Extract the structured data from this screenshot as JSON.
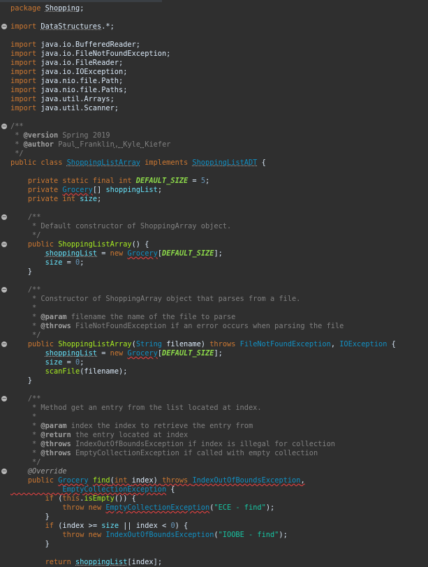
{
  "editor": {
    "lines": [
      {
        "fold": false,
        "tokens": [
          [
            "kw",
            "package "
          ],
          [
            "pl",
            "Shopping"
          ],
          [
            "pl",
            ";"
          ]
        ],
        "spell": [
          1
        ]
      },
      {
        "fold": false,
        "tokens": []
      },
      {
        "fold": true,
        "tokens": [
          [
            "kw",
            "import "
          ],
          [
            "pl",
            "DataStructures"
          ],
          [
            "pl",
            ".*;"
          ]
        ],
        "spell": [
          1
        ]
      },
      {
        "fold": false,
        "tokens": []
      },
      {
        "fold": false,
        "tokens": [
          [
            "kw",
            "import "
          ],
          [
            "pl",
            "java.io.BufferedReader;"
          ]
        ]
      },
      {
        "fold": false,
        "tokens": [
          [
            "kw",
            "import "
          ],
          [
            "pl",
            "java.io.FileNotFoundException;"
          ]
        ]
      },
      {
        "fold": false,
        "tokens": [
          [
            "kw",
            "import "
          ],
          [
            "pl",
            "java.io.FileReader;"
          ]
        ]
      },
      {
        "fold": false,
        "tokens": [
          [
            "kw",
            "import "
          ],
          [
            "pl",
            "java.io.IOException;"
          ]
        ]
      },
      {
        "fold": false,
        "tokens": [
          [
            "kw",
            "import "
          ],
          [
            "pl",
            "java.nio.file.Path;"
          ]
        ]
      },
      {
        "fold": false,
        "tokens": [
          [
            "kw",
            "import "
          ],
          [
            "pl",
            "java.nio.file.Paths;"
          ]
        ]
      },
      {
        "fold": false,
        "tokens": [
          [
            "kw",
            "import "
          ],
          [
            "pl",
            "java.util.Arrays;"
          ]
        ]
      },
      {
        "fold": false,
        "tokens": [
          [
            "kw",
            "import "
          ],
          [
            "pl",
            "java.util.Scanner;"
          ]
        ]
      },
      {
        "fold": false,
        "tokens": []
      },
      {
        "fold": true,
        "tokens": [
          [
            "cm",
            "/**"
          ]
        ]
      },
      {
        "fold": false,
        "tokens": [
          [
            "cm",
            " * "
          ],
          [
            "tag",
            "@version"
          ],
          [
            "cm",
            " Spring 2019"
          ]
        ]
      },
      {
        "fold": false,
        "tokens": [
          [
            "cm",
            " * "
          ],
          [
            "tag",
            "@author"
          ],
          [
            "cm",
            " "
          ],
          [
            "cm",
            "Paul"
          ],
          [
            "cm",
            " "
          ],
          [
            "cm",
            "Franklin"
          ],
          [
            "cm",
            ", "
          ],
          [
            "cm",
            "Kyle"
          ],
          [
            "cm",
            " "
          ],
          [
            "cm",
            "Kiefer"
          ]
        ],
        "spell": [
          4,
          6,
          8,
          10
        ]
      },
      {
        "fold": false,
        "tokens": [
          [
            "cm",
            " */"
          ]
        ]
      },
      {
        "fold": false,
        "tokens": [
          [
            "kw",
            "public class "
          ],
          [
            "ty",
            "ShoppingListArray"
          ],
          [
            "kw",
            " implements "
          ],
          [
            "ty",
            "ShoppingListADT"
          ],
          [
            "pl",
            " {"
          ]
        ],
        "spell": [
          1,
          3
        ]
      },
      {
        "fold": false,
        "tokens": []
      },
      {
        "fold": false,
        "tokens": [
          [
            "pl",
            "    "
          ],
          [
            "kw",
            "private static final int "
          ],
          [
            "cst",
            "DEFAULT_SIZE"
          ],
          [
            "pl",
            " = "
          ],
          [
            "num",
            "5"
          ],
          [
            "pl",
            ";"
          ]
        ]
      },
      {
        "fold": false,
        "tokens": [
          [
            "pl",
            "    "
          ],
          [
            "kw",
            "private "
          ],
          [
            "ty",
            "Grocery"
          ],
          [
            "pl",
            "[] "
          ],
          [
            "fld",
            "shoppingList"
          ],
          [
            "pl",
            ";"
          ]
        ],
        "err": [
          2
        ]
      },
      {
        "fold": false,
        "tokens": [
          [
            "pl",
            "    "
          ],
          [
            "kw",
            "private int "
          ],
          [
            "fld",
            "size"
          ],
          [
            "pl",
            ";"
          ]
        ]
      },
      {
        "fold": false,
        "tokens": []
      },
      {
        "fold": true,
        "tokens": [
          [
            "pl",
            "    "
          ],
          [
            "cm",
            "/**"
          ]
        ]
      },
      {
        "fold": false,
        "tokens": [
          [
            "cm",
            "     * Default constructor of ShoppingArray object."
          ]
        ]
      },
      {
        "fold": false,
        "tokens": [
          [
            "cm",
            "     */"
          ]
        ]
      },
      {
        "fold": true,
        "tokens": [
          [
            "pl",
            "    "
          ],
          [
            "kw",
            "public "
          ],
          [
            "mth",
            "ShoppingListArray"
          ],
          [
            "pl",
            "() {"
          ]
        ]
      },
      {
        "fold": false,
        "tokens": [
          [
            "pl",
            "        "
          ],
          [
            "fld",
            "shoppingList"
          ],
          [
            "pl",
            " = "
          ],
          [
            "kw",
            "new "
          ],
          [
            "ty",
            "Grocery"
          ],
          [
            "pl",
            "["
          ],
          [
            "cst",
            "DEFAULT_SIZE"
          ],
          [
            "pl",
            "];"
          ]
        ],
        "spell": [
          1
        ],
        "err": [
          4
        ]
      },
      {
        "fold": false,
        "tokens": [
          [
            "pl",
            "        "
          ],
          [
            "fld",
            "size"
          ],
          [
            "pl",
            " = "
          ],
          [
            "num",
            "0"
          ],
          [
            "pl",
            ";"
          ]
        ]
      },
      {
        "fold": false,
        "tokens": [
          [
            "pl",
            "    }"
          ]
        ]
      },
      {
        "fold": false,
        "tokens": []
      },
      {
        "fold": true,
        "tokens": [
          [
            "pl",
            "    "
          ],
          [
            "cm",
            "/**"
          ]
        ]
      },
      {
        "fold": false,
        "tokens": [
          [
            "cm",
            "     * Constructor of ShoppingArray object that parses from a file."
          ]
        ]
      },
      {
        "fold": false,
        "tokens": [
          [
            "cm",
            "     *"
          ]
        ]
      },
      {
        "fold": false,
        "tokens": [
          [
            "cm",
            "     * "
          ],
          [
            "tag",
            "@param"
          ],
          [
            "cm",
            " filename the name of the file to parse"
          ]
        ]
      },
      {
        "fold": false,
        "tokens": [
          [
            "cm",
            "     * "
          ],
          [
            "tag",
            "@throws"
          ],
          [
            "cm",
            " FileNotFoundException if an error occurs when parsing the file"
          ]
        ]
      },
      {
        "fold": false,
        "tokens": [
          [
            "cm",
            "     */"
          ]
        ]
      },
      {
        "fold": true,
        "tokens": [
          [
            "pl",
            "    "
          ],
          [
            "kw",
            "public "
          ],
          [
            "mth",
            "ShoppingListArray"
          ],
          [
            "pl",
            "("
          ],
          [
            "ty",
            "String"
          ],
          [
            "pl",
            " filename) "
          ],
          [
            "kw",
            "throws "
          ],
          [
            "ty",
            "FileNotFoundException"
          ],
          [
            "pl",
            ", "
          ],
          [
            "ty",
            "IOException"
          ],
          [
            "pl",
            " {"
          ]
        ]
      },
      {
        "fold": false,
        "tokens": [
          [
            "pl",
            "        "
          ],
          [
            "fld",
            "shoppingList"
          ],
          [
            "pl",
            " = "
          ],
          [
            "kw",
            "new "
          ],
          [
            "ty",
            "Grocery"
          ],
          [
            "pl",
            "["
          ],
          [
            "cst",
            "DEFAULT_SIZE"
          ],
          [
            "pl",
            "];"
          ]
        ],
        "spell": [
          1
        ],
        "err": [
          4
        ]
      },
      {
        "fold": false,
        "tokens": [
          [
            "pl",
            "        "
          ],
          [
            "fld",
            "size"
          ],
          [
            "pl",
            " = "
          ],
          [
            "num",
            "0"
          ],
          [
            "pl",
            ";"
          ]
        ]
      },
      {
        "fold": false,
        "tokens": [
          [
            "pl",
            "        "
          ],
          [
            "mth",
            "scanFile"
          ],
          [
            "pl",
            "(filename);"
          ]
        ]
      },
      {
        "fold": false,
        "tokens": [
          [
            "pl",
            "    }"
          ]
        ]
      },
      {
        "fold": false,
        "tokens": []
      },
      {
        "fold": true,
        "tokens": [
          [
            "pl",
            "    "
          ],
          [
            "cm",
            "/**"
          ]
        ]
      },
      {
        "fold": false,
        "tokens": [
          [
            "cm",
            "     * Method get an entry from the list located at index."
          ]
        ]
      },
      {
        "fold": false,
        "tokens": [
          [
            "cm",
            "     *"
          ]
        ]
      },
      {
        "fold": false,
        "tokens": [
          [
            "cm",
            "     * "
          ],
          [
            "tag",
            "@param"
          ],
          [
            "cm",
            " index the index to retrieve the entry from"
          ]
        ]
      },
      {
        "fold": false,
        "tokens": [
          [
            "cm",
            "     * "
          ],
          [
            "tag",
            "@return"
          ],
          [
            "cm",
            " the entry located at index"
          ]
        ]
      },
      {
        "fold": false,
        "tokens": [
          [
            "cm",
            "     * "
          ],
          [
            "tag",
            "@throws"
          ],
          [
            "cm",
            " IndexOutOfBoundsException if index is illegal for collection"
          ]
        ]
      },
      {
        "fold": false,
        "tokens": [
          [
            "cm",
            "     * "
          ],
          [
            "tag",
            "@throws"
          ],
          [
            "cm",
            " EmptyCollectionException if called with empty collection"
          ]
        ]
      },
      {
        "fold": false,
        "tokens": [
          [
            "cm",
            "     */"
          ]
        ]
      },
      {
        "fold": true,
        "tokens": [
          [
            "pl",
            "    "
          ],
          [
            "ann",
            "@Override"
          ]
        ]
      },
      {
        "fold": false,
        "tokens": [
          [
            "pl",
            "    "
          ],
          [
            "kw",
            "public "
          ],
          [
            "ty",
            "Grocery"
          ],
          [
            "pl",
            " "
          ],
          [
            "mth",
            "find"
          ],
          [
            "pl",
            "("
          ],
          [
            "kw",
            "int "
          ],
          [
            "pl",
            "index) "
          ],
          [
            "kw",
            "throws "
          ],
          [
            "ty",
            "IndexOutOfBoundsException"
          ],
          [
            "pl",
            ","
          ]
        ],
        "err": [
          2,
          4,
          5,
          6,
          7,
          8,
          9,
          10
        ]
      },
      {
        "fold": false,
        "tokens": [
          [
            "pl",
            "            "
          ],
          [
            "ty",
            "EmptyCollectionException"
          ],
          [
            "pl",
            " {"
          ]
        ],
        "err": [
          0,
          1
        ]
      },
      {
        "fold": false,
        "tokens": [
          [
            "pl",
            "        "
          ],
          [
            "kw",
            "if "
          ],
          [
            "pl",
            "("
          ],
          [
            "kw",
            "this"
          ],
          [
            "pl",
            "."
          ],
          [
            "mth",
            "isEmpty"
          ],
          [
            "pl",
            "()) {"
          ]
        ]
      },
      {
        "fold": false,
        "tokens": [
          [
            "pl",
            "            "
          ],
          [
            "kw",
            "throw new "
          ],
          [
            "ty",
            "EmptyCollectionException"
          ],
          [
            "pl",
            "("
          ],
          [
            "str",
            "\"ECE - find\""
          ],
          [
            "pl",
            ");"
          ]
        ],
        "err": [
          2
        ]
      },
      {
        "fold": false,
        "tokens": [
          [
            "pl",
            "        }"
          ]
        ]
      },
      {
        "fold": false,
        "tokens": [
          [
            "pl",
            "        "
          ],
          [
            "kw",
            "if "
          ],
          [
            "pl",
            "(index >= "
          ],
          [
            "fld",
            "size"
          ],
          [
            "pl",
            " || index < "
          ],
          [
            "num",
            "0"
          ],
          [
            "pl",
            ") {"
          ]
        ]
      },
      {
        "fold": false,
        "tokens": [
          [
            "pl",
            "            "
          ],
          [
            "kw",
            "throw new "
          ],
          [
            "ty",
            "IndexOutOfBoundsException"
          ],
          [
            "pl",
            "("
          ],
          [
            "str",
            "\"IOOBE - find\""
          ],
          [
            "pl",
            ");"
          ]
        ]
      },
      {
        "fold": false,
        "tokens": [
          [
            "pl",
            "        }"
          ]
        ]
      },
      {
        "fold": false,
        "tokens": []
      },
      {
        "fold": false,
        "tokens": [
          [
            "pl",
            "        "
          ],
          [
            "kw",
            "return "
          ],
          [
            "fld",
            "shoppingList"
          ],
          [
            "pl",
            "[index];"
          ]
        ],
        "spell": [
          2
        ]
      }
    ]
  }
}
